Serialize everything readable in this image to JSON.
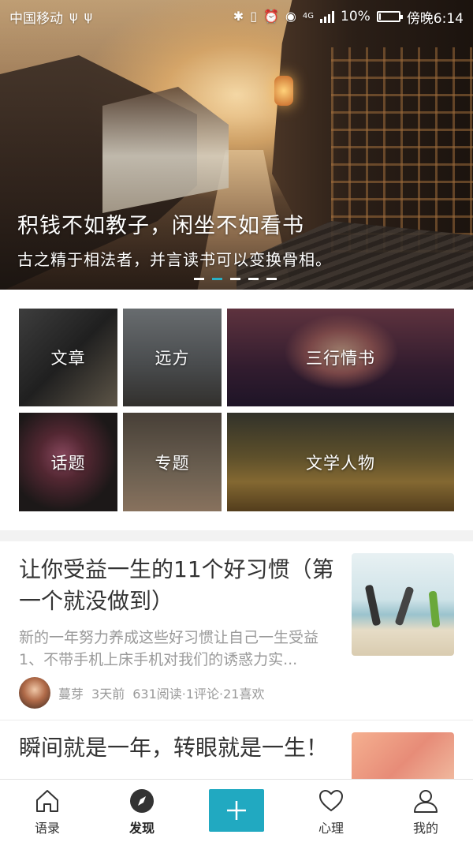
{
  "status_bar": {
    "carrier": "中国移动",
    "network": "4G",
    "battery": "10%",
    "battery_level": 0.1,
    "time": "傍晚6:14"
  },
  "banner": {
    "title": "积钱不如教子，闲坐不如看书",
    "subtitle": "古之精于相法者，并言读书可以变换骨相。",
    "slide_count": 5,
    "active_slide": 1
  },
  "categories": [
    {
      "label": "文章"
    },
    {
      "label": "远方"
    },
    {
      "label": "三行情书"
    },
    {
      "label": "话题"
    },
    {
      "label": "专题"
    },
    {
      "label": "文学人物"
    }
  ],
  "articles": [
    {
      "title": "让你受益一生的11个好习惯（第一个就没做到）",
      "excerpt": "新的一年努力养成这些好习惯让自己一生受益1、不带手机上床手机对我们的诱惑力实...",
      "author": "蔓芽",
      "time": "3天前",
      "stats": "631阅读·1评论·21喜欢"
    },
    {
      "title": "瞬间就是一年，转眼就是一生！"
    }
  ],
  "bottom_nav": {
    "items": [
      {
        "label": "语录",
        "icon": "home-icon"
      },
      {
        "label": "发现",
        "icon": "compass-icon"
      },
      {
        "label": "",
        "icon": "plus-icon"
      },
      {
        "label": "心理",
        "icon": "heart-icon"
      },
      {
        "label": "我的",
        "icon": "user-icon"
      }
    ],
    "active": "发现",
    "accent": "#21a9c1"
  }
}
